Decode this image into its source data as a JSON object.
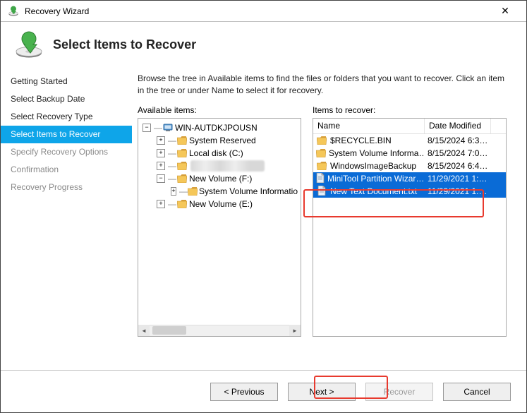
{
  "title": "Recovery Wizard",
  "header": {
    "title": "Select Items to Recover"
  },
  "sidebar": {
    "items": [
      {
        "label": "Getting Started",
        "state": "done"
      },
      {
        "label": "Select Backup Date",
        "state": "done"
      },
      {
        "label": "Select Recovery Type",
        "state": "done"
      },
      {
        "label": "Select Items to Recover",
        "state": "active"
      },
      {
        "label": "Specify Recovery Options",
        "state": "disabled"
      },
      {
        "label": "Confirmation",
        "state": "disabled"
      },
      {
        "label": "Recovery Progress",
        "state": "disabled"
      }
    ]
  },
  "instructions": "Browse the tree in Available items to find the files or folders that you want to recover. Click an item in the tree or under Name to select it for recovery.",
  "panels": {
    "available_label": "Available items:",
    "recover_label": "Items to recover:"
  },
  "tree": {
    "root": {
      "label": "WIN-AUTDKJPOUSN",
      "icon": "computer",
      "exp": "-"
    },
    "children": [
      {
        "label": "System Reserved",
        "icon": "folder",
        "exp": "+"
      },
      {
        "label": "Local disk (C:)",
        "icon": "folder",
        "exp": "+"
      },
      {
        "label": "",
        "icon": "folder",
        "exp": "+",
        "blur": true
      },
      {
        "label": "New Volume (F:)",
        "icon": "folder",
        "exp": "-",
        "children": [
          {
            "label": "System Volume Informatio",
            "icon": "folder",
            "exp": "+"
          }
        ]
      },
      {
        "label": "New Volume (E:)",
        "icon": "folder",
        "exp": "+"
      }
    ]
  },
  "list": {
    "columns": {
      "name": "Name",
      "date": "Date Modified"
    },
    "rows": [
      {
        "name": "$RECYCLE.BIN",
        "date": "8/15/2024 6:3…",
        "icon": "folder",
        "selected": false
      },
      {
        "name": "System Volume Informa…",
        "date": "8/15/2024 7:0…",
        "icon": "folder",
        "selected": false
      },
      {
        "name": "WindowsImageBackup",
        "date": "8/15/2024 6:4…",
        "icon": "folder",
        "selected": false
      },
      {
        "name": "MiniTool Partition Wizar…",
        "date": "11/29/2021 1:…",
        "icon": "file",
        "selected": true
      },
      {
        "name": "New Text Document.txt",
        "date": "11/29/2021 1:…",
        "icon": "file",
        "selected": true
      }
    ]
  },
  "buttons": {
    "previous": "< Previous",
    "next": "Next >",
    "recover": "Recover",
    "cancel": "Cancel"
  },
  "icons": {
    "close": "✕"
  }
}
